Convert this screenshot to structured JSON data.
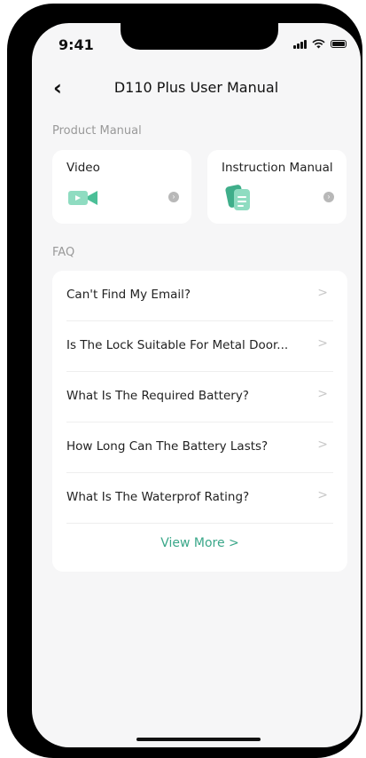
{
  "status": {
    "time": "9:41"
  },
  "nav": {
    "title": "D110 Plus User Manual"
  },
  "product_manual": {
    "section_label": "Product Manual",
    "cards": [
      {
        "label": "Video",
        "icon": "video-camera-icon"
      },
      {
        "label": "Instruction Manual",
        "icon": "document-icon"
      }
    ]
  },
  "faq": {
    "section_label": "FAQ",
    "items": [
      "Can't Find My Email?",
      "Is The Lock Suitable For Metal Door...",
      "What Is The Required Battery?",
      "How Long Can The Battery Lasts?",
      "What Is The Waterprof Rating?"
    ],
    "view_more": "View More",
    "view_more_chevron": ">",
    "row_chevron": ">"
  },
  "colors": {
    "accent": "#3aa789",
    "icon_green": "#5cc7a4",
    "background": "#f6f6f7"
  }
}
